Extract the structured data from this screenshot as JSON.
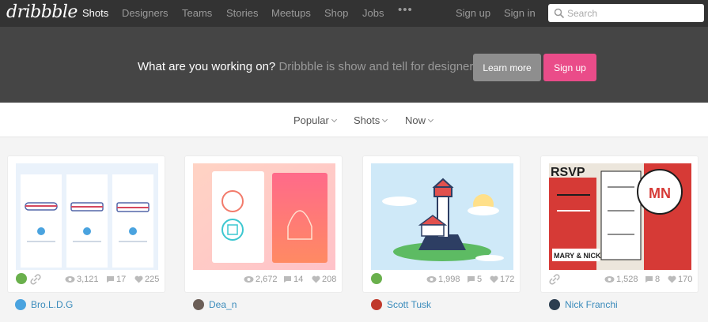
{
  "nav": {
    "logo": "dribbble",
    "links": [
      "Shots",
      "Designers",
      "Teams",
      "Stories",
      "Meetups",
      "Shop",
      "Jobs"
    ],
    "more": "•••",
    "sign_up": "Sign up",
    "sign_in": "Sign in",
    "search_placeholder": "Search"
  },
  "hero": {
    "question": "What are you working on?",
    "tagline": "Dribbble is show and tell for designers.",
    "learn_more": "Learn more",
    "sign_up": "Sign up"
  },
  "filters": [
    "Popular",
    "Shots",
    "Now"
  ],
  "shots": [
    {
      "views": "3,121",
      "comments": "17",
      "likes": "225",
      "author": "Bro.L.D.G",
      "rebound": true,
      "link": true
    },
    {
      "views": "2,672",
      "comments": "14",
      "likes": "208",
      "author": "Dea_n",
      "rebound": false,
      "link": false
    },
    {
      "views": "1,998",
      "comments": "5",
      "likes": "172",
      "author": "Scott Tusk",
      "rebound": true,
      "link": false
    },
    {
      "views": "1,528",
      "comments": "8",
      "likes": "170",
      "author": "Nick Franchi",
      "rebound": false,
      "link": true
    }
  ],
  "thumb_text": {
    "rsvp": "RSVP",
    "couple": "MARY & NICK",
    "monogram": "MN"
  },
  "colors": {
    "nav_bg": "#333333",
    "hero_bg": "#454545",
    "accent_pink": "#ea4c89",
    "link_blue": "#3a8bbb"
  }
}
